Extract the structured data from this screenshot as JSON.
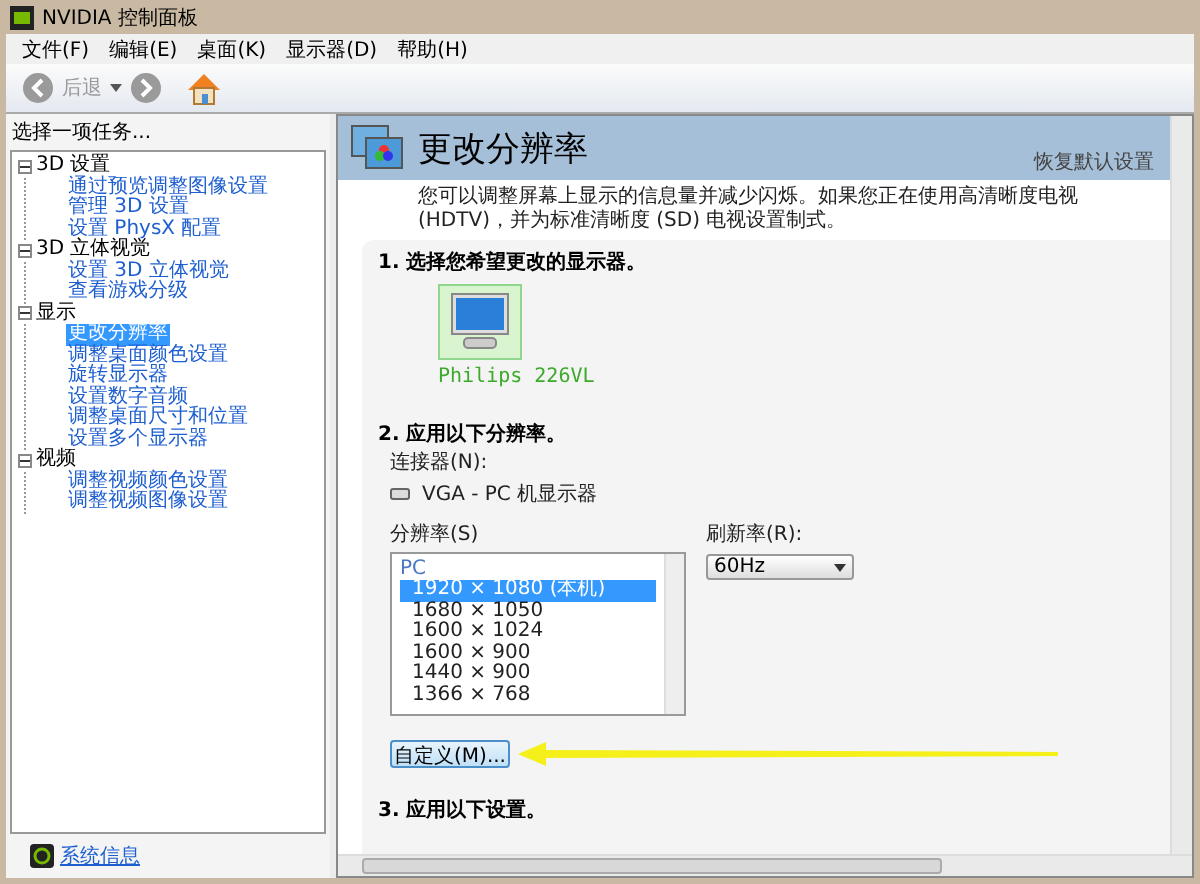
{
  "window": {
    "title": "NVIDIA 控制面板"
  },
  "menu": [
    "文件(F)",
    "编辑(E)",
    "桌面(K)",
    "显示器(D)",
    "帮助(H)"
  ],
  "toolbar": {
    "back_label": "后退"
  },
  "sidebar": {
    "heading": "选择一项任务...",
    "tree": [
      {
        "label": "3D 设置",
        "expanded": true,
        "children": [
          {
            "label": "通过预览调整图像设置",
            "selected": false
          },
          {
            "label": "管理 3D 设置",
            "selected": false
          },
          {
            "label": "设置 PhysX 配置",
            "selected": false
          }
        ]
      },
      {
        "label": "3D 立体视觉",
        "expanded": true,
        "children": [
          {
            "label": "设置 3D 立体视觉",
            "selected": false
          },
          {
            "label": "查看游戏分级",
            "selected": false
          }
        ]
      },
      {
        "label": "显示",
        "expanded": true,
        "children": [
          {
            "label": "更改分辨率",
            "selected": true
          },
          {
            "label": "调整桌面颜色设置",
            "selected": false
          },
          {
            "label": "旋转显示器",
            "selected": false
          },
          {
            "label": "设置数字音频",
            "selected": false
          },
          {
            "label": "调整桌面尺寸和位置",
            "selected": false
          },
          {
            "label": "设置多个显示器",
            "selected": false
          }
        ]
      },
      {
        "label": "视频",
        "expanded": true,
        "children": [
          {
            "label": "调整视频颜色设置",
            "selected": false
          },
          {
            "label": "调整视频图像设置",
            "selected": false
          }
        ]
      }
    ],
    "system_info": "系统信息"
  },
  "page": {
    "title": "更改分辨率",
    "restore_link": "恢复默认设置",
    "description": "您可以调整屏幕上显示的信息量并减少闪烁。如果您正在使用高清晰度电视 (HDTV)，并为标准清晰度 (SD) 电视设置制式。",
    "section_1": {
      "heading": "1. 选择您希望更改的显示器。",
      "displays": [
        {
          "name": "Philips 226VL",
          "selected": true
        }
      ]
    },
    "section_2": {
      "heading": "2. 应用以下分辨率。",
      "connector_label": "连接器(N):",
      "connector": "VGA - PC 机显示器",
      "resolution_label": "分辨率(S)",
      "group": "PC",
      "resolutions": [
        {
          "label": "1920 × 1080 (本机)",
          "selected": true
        },
        {
          "label": "1680 × 1050",
          "selected": false
        },
        {
          "label": "1600 × 1024",
          "selected": false
        },
        {
          "label": "1600 × 900",
          "selected": false
        },
        {
          "label": "1440 × 900",
          "selected": false
        },
        {
          "label": "1366 × 768",
          "selected": false
        }
      ],
      "refresh_label": "刷新率(R):",
      "refresh_value": "60Hz",
      "custom_button": "自定义(M)..."
    },
    "section_3": {
      "heading": "3. 应用以下设置。"
    }
  }
}
